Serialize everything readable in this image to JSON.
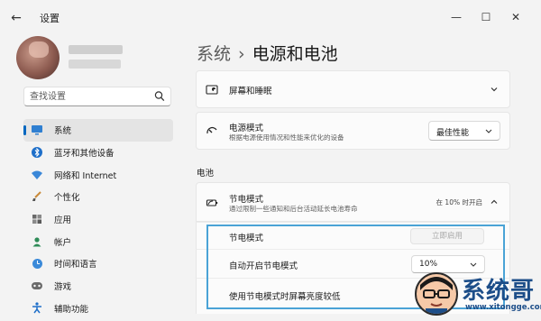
{
  "window": {
    "title": "设置",
    "back_glyph": "←",
    "minimize_glyph": "—",
    "maximize_glyph": "☐",
    "close_glyph": "✕"
  },
  "search": {
    "placeholder": "查找设置"
  },
  "sidebar": {
    "items": [
      {
        "label": "系统",
        "icon": "system-monitor-icon",
        "active": true
      },
      {
        "label": "蓝牙和其他设备",
        "icon": "bluetooth-icon"
      },
      {
        "label": "网络和 Internet",
        "icon": "wifi-icon"
      },
      {
        "label": "个性化",
        "icon": "brush-icon"
      },
      {
        "label": "应用",
        "icon": "apps-icon"
      },
      {
        "label": "帐户",
        "icon": "person-icon"
      },
      {
        "label": "时间和语言",
        "icon": "globe-clock-icon"
      },
      {
        "label": "游戏",
        "icon": "gamepad-icon"
      },
      {
        "label": "辅助功能",
        "icon": "accessibility-icon"
      }
    ]
  },
  "breadcrumb": {
    "root": "系统",
    "separator": "›",
    "current": "电源和电池"
  },
  "cards": {
    "screen_sleep": {
      "title": "屏幕和睡眠"
    },
    "power_mode": {
      "title": "电源模式",
      "subtitle": "根据电源使用情况和性能来优化的设备",
      "value": "最佳性能"
    }
  },
  "battery_section": {
    "label": "电池",
    "saver": {
      "title": "节电模式",
      "subtitle": "通过限制一些通知和后台活动延长电池寿命",
      "status": "在 10% 时开启",
      "rows": {
        "saver_toggle": {
          "label": "节电模式",
          "button": "立即启用"
        },
        "auto_on": {
          "label": "自动开启节电模式",
          "value": "10%"
        },
        "dim_screen": {
          "label": "使用节电模式时屏幕亮度较低"
        }
      }
    }
  },
  "watermark": {
    "text": "系统哥",
    "url": "www.xitongge.com"
  },
  "colors": {
    "accent": "#0067c0",
    "highlight": "#4aa3d6",
    "watermark": "#1d4e89"
  }
}
